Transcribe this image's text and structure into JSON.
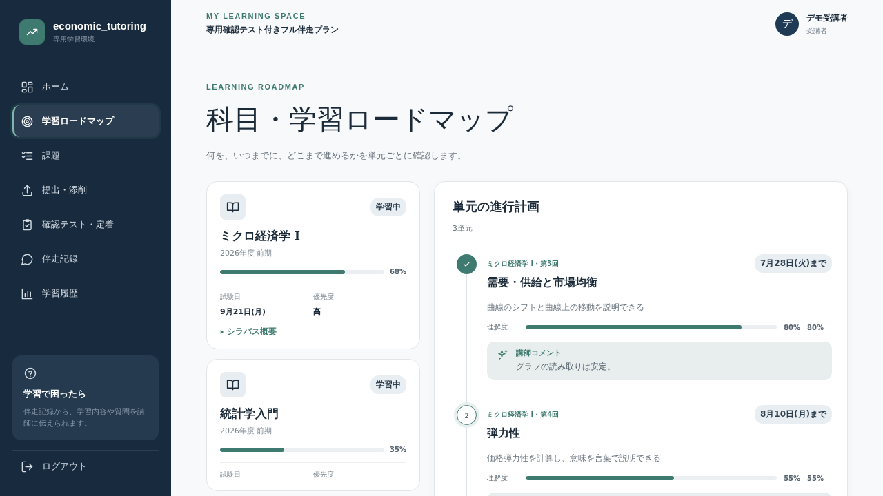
{
  "sidebar": {
    "brand": {
      "name": "economic_tutoring",
      "subtitle": "専用学習環境"
    },
    "items": [
      {
        "label": "ホーム",
        "selected": false
      },
      {
        "label": "学習ロードマップ",
        "selected": true
      },
      {
        "label": "課題",
        "selected": false
      },
      {
        "label": "提出・添削",
        "selected": false
      },
      {
        "label": "確認テスト・定着",
        "selected": false
      },
      {
        "label": "伴走記録",
        "selected": false
      },
      {
        "label": "学習履歴",
        "selected": false
      }
    ],
    "help": {
      "title": "学習で困ったら",
      "text": "伴走記録から、学習内容や質問を講師に伝えられます。"
    },
    "logout": "ログアウト"
  },
  "header": {
    "eyebrow": "MY LEARNING SPACE",
    "plan": "専用確認テスト付きフル伴走プラン",
    "user": {
      "avatar": "デ",
      "name": "デモ受講者",
      "role": "受講者"
    }
  },
  "page": {
    "eyebrow": "LEARNING ROADMAP",
    "title": "科目・学習ロードマップ",
    "description": "何を、いつまでに、どこまで進めるかを単元ごとに確認します。"
  },
  "subjects": [
    {
      "status": "学習中",
      "name": "ミクロ経済学 I",
      "term": "2026年度 前期",
      "level": 0.76,
      "percent": "68%",
      "exam_label": "試験日",
      "exam_date": "9月21日(月)",
      "priority_label": "優先度",
      "priority": "高",
      "syllabus": "シラバス概要"
    },
    {
      "status": "学習中",
      "name": "統計学入門",
      "term": "2026年度 前期",
      "level": 0.39,
      "percent": "35%",
      "exam_label": "試験日",
      "priority_label": "優先度"
    }
  ],
  "plan": {
    "title": "単元の進行計画",
    "count": "3単元",
    "units": [
      {
        "completed": true,
        "course": "ミクロ経済学 I・第3回",
        "due": "7月28日(火)まで",
        "title": "需要・供給と市場均衡",
        "goal": "曲線のシフトと曲線上の移動を説明できる",
        "meter_label": "理解度",
        "level": 0.86,
        "reading_1": "80%",
        "reading_2": "80%",
        "comment_label": "講師コメント",
        "comment": "グラフの読み取りは安定。"
      },
      {
        "completed": false,
        "number": "2",
        "course": "ミクロ経済学 I・第4回",
        "due": "8月10日(月)まで",
        "title": "弾力性",
        "goal": "価格弾力性を計算し、意味を言葉で説明できる",
        "meter_label": "理解度",
        "level": 0.59,
        "reading_1": "55%",
        "reading_2": "55%"
      }
    ]
  }
}
